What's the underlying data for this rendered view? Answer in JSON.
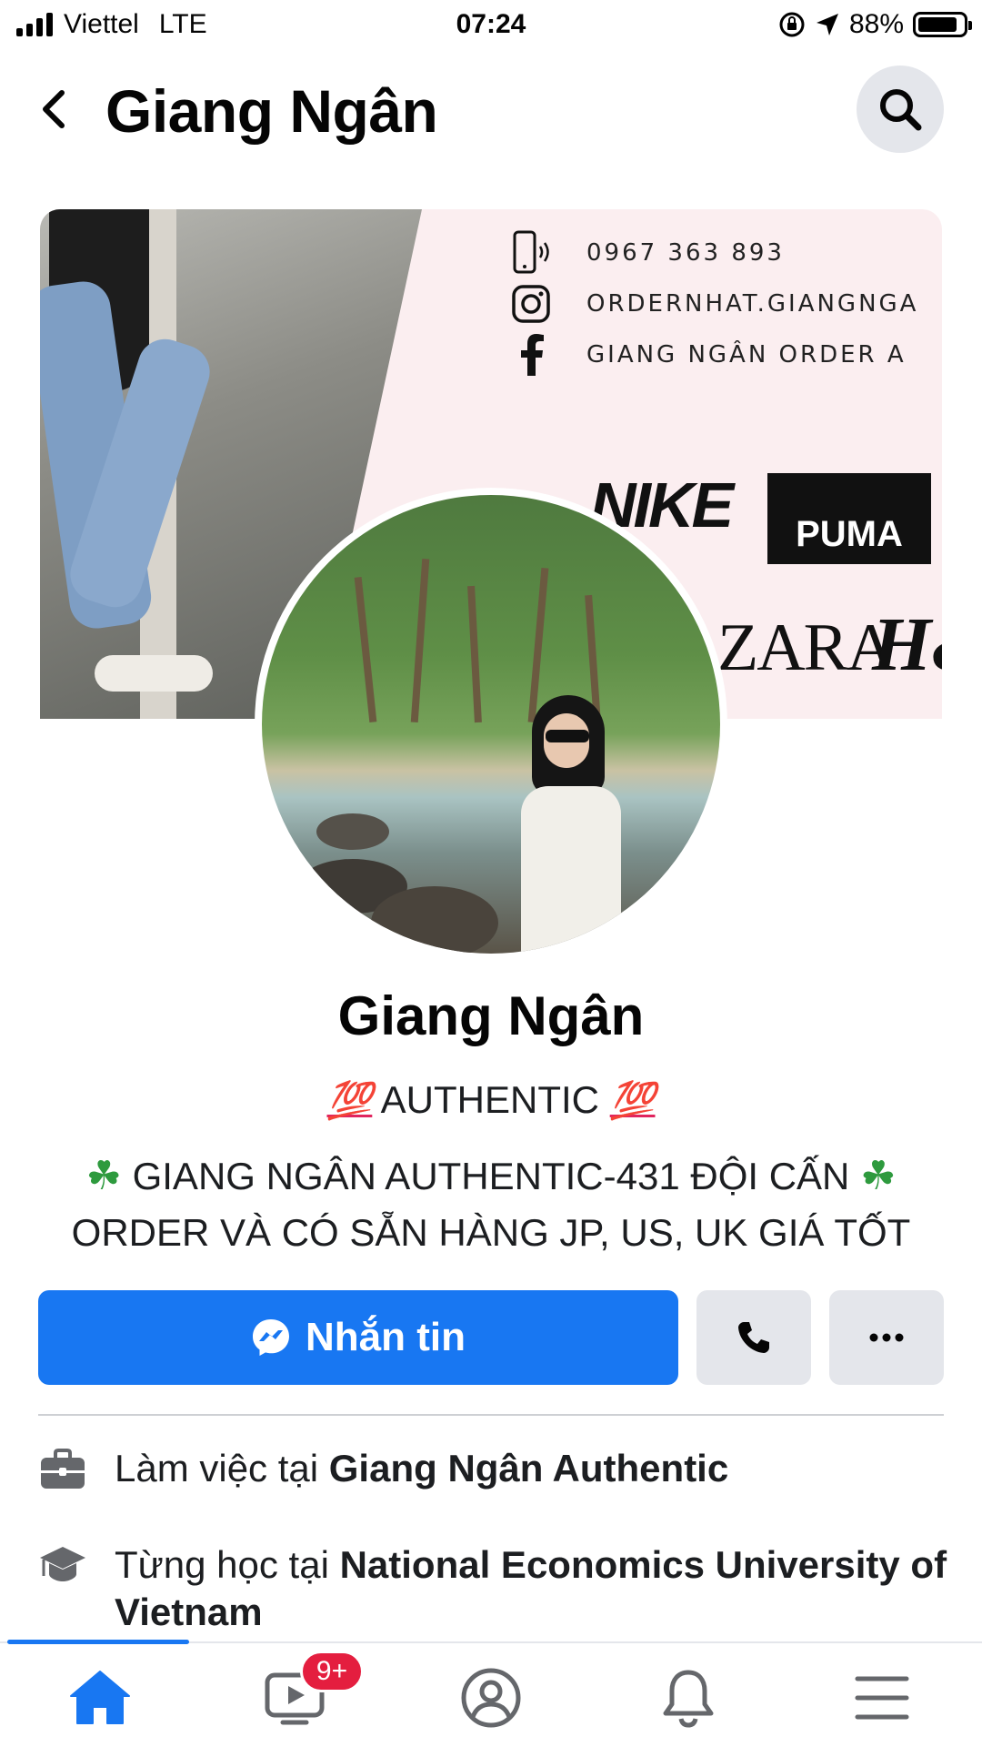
{
  "status_bar": {
    "carrier": "Viettel",
    "network": "LTE",
    "time": "07:24",
    "battery": "88%",
    "battery_level": 0.88,
    "icons": [
      "signal-icon",
      "orientation-lock-icon",
      "location-arrow-icon",
      "battery-icon"
    ]
  },
  "header": {
    "title": "Giang Ngân",
    "back_icon": "back-chevron-icon",
    "search_icon": "search-icon"
  },
  "cover": {
    "phone": "0967 363 893",
    "instagram": "ORDERNHAT.GIANGNGA",
    "facebook": "GIANG NGÂN ORDER A",
    "brands": [
      "NIKE",
      "PUMA",
      "ZARA",
      "H&M"
    ]
  },
  "profile": {
    "name": "Giang Ngân",
    "bio_line1": "AUTHENTIC",
    "bio_emoji": "💯",
    "bio_line2": "GIANG NGÂN AUTHENTIC-431 ĐỘI CẤN",
    "bio_line3": "ORDER VÀ CÓ SẴN HÀNG JP, US, UK GIÁ TỐT",
    "clover": "☘"
  },
  "actions": {
    "message_label": "Nhắn tin",
    "colors": {
      "primary": "#1877f2",
      "secondary": "#e4e6eb"
    }
  },
  "info": {
    "work_prefix": "Làm việc tại ",
    "work_place": "Giang Ngân Authentic",
    "study_prefix": "Từng học tại ",
    "study_place": "National Economics University of Vietnam"
  },
  "bottom_nav": {
    "items": [
      "home-icon",
      "watch-icon",
      "profile-icon",
      "notifications-icon",
      "menu-icon"
    ],
    "active": "home",
    "watch_badge": "9+",
    "badge_color": "#e41e3f"
  }
}
